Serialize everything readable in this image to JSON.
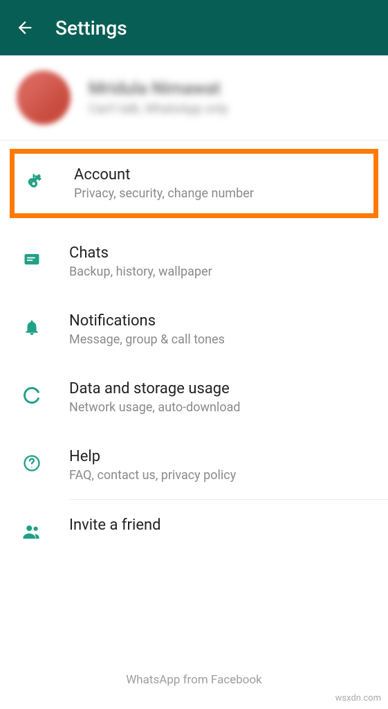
{
  "header": {
    "title": "Settings"
  },
  "profile": {
    "name": "Mridula Nimawat",
    "status": "Can't talk, WhatsApp only"
  },
  "items": [
    {
      "icon": "key",
      "title": "Account",
      "sub": "Privacy, security, change number",
      "highlighted": true
    },
    {
      "icon": "chat",
      "title": "Chats",
      "sub": "Backup, history, wallpaper"
    },
    {
      "icon": "bell",
      "title": "Notifications",
      "sub": "Message, group & call tones"
    },
    {
      "icon": "data",
      "title": "Data and storage usage",
      "sub": "Network usage, auto-download"
    },
    {
      "icon": "help",
      "title": "Help",
      "sub": "FAQ, contact us, privacy policy"
    },
    {
      "icon": "people",
      "title": "Invite a friend",
      "sub": ""
    }
  ],
  "footer": "WhatsApp from Facebook",
  "watermark": "wsxdn.com"
}
